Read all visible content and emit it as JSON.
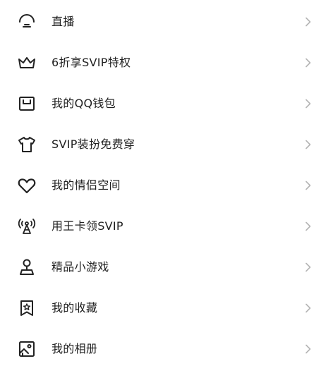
{
  "menu": {
    "items": [
      {
        "label": "直播",
        "icon": "live-broadcast-icon"
      },
      {
        "label": "6折享SVIP特权",
        "icon": "crown-icon"
      },
      {
        "label": "我的QQ钱包",
        "icon": "wallet-icon"
      },
      {
        "label": "SVIP装扮免费穿",
        "icon": "tshirt-icon"
      },
      {
        "label": "我的情侣空间",
        "icon": "heart-icon"
      },
      {
        "label": "用王卡领SVIP",
        "icon": "signal-tower-icon"
      },
      {
        "label": "精品小游戏",
        "icon": "joystick-icon"
      },
      {
        "label": "我的收藏",
        "icon": "bookmark-star-icon"
      },
      {
        "label": "我的相册",
        "icon": "photo-album-icon"
      }
    ]
  },
  "colors": {
    "background": "#ffffff",
    "text": "#1f1f1f",
    "icon_stroke": "#222222",
    "chevron": "#b5b5b5"
  }
}
